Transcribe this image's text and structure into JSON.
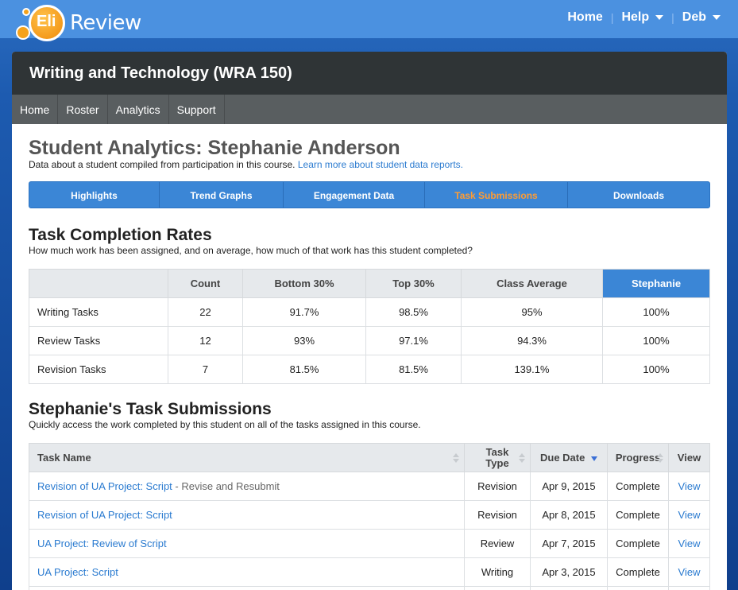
{
  "brand": {
    "logo_text": "Eli",
    "wordmark": "Review"
  },
  "topnav": {
    "home": "Home",
    "help": "Help",
    "user": "Deb"
  },
  "course": {
    "title": "Writing and Technology (WRA 150)"
  },
  "coursenav": [
    "Home",
    "Roster",
    "Analytics",
    "Support"
  ],
  "page": {
    "title": "Student Analytics: Stephanie Anderson",
    "subtitle": "Data about a student compiled from participation in this course.",
    "learn_more": "Learn more about student data reports."
  },
  "tabs": [
    {
      "label": "Highlights",
      "active": false
    },
    {
      "label": "Trend Graphs",
      "active": false
    },
    {
      "label": "Engagement Data",
      "active": false
    },
    {
      "label": "Task Submissions",
      "active": true
    },
    {
      "label": "Downloads",
      "active": false
    }
  ],
  "completion": {
    "heading": "Task Completion Rates",
    "description": "How much work has been assigned, and on average, how much of that work has this student completed?",
    "columns": [
      "",
      "Count",
      "Bottom 30%",
      "Top 30%",
      "Class Average",
      "Stephanie"
    ],
    "rows": [
      [
        "Writing Tasks",
        "22",
        "91.7%",
        "98.5%",
        "95%",
        "100%"
      ],
      [
        "Review Tasks",
        "12",
        "93%",
        "97.1%",
        "94.3%",
        "100%"
      ],
      [
        "Revision Tasks",
        "7",
        "81.5%",
        "81.5%",
        "139.1%",
        "100%"
      ]
    ]
  },
  "submissions": {
    "heading": "Stephanie's Task Submissions",
    "description": "Quickly access the work completed by this student on all of the tasks assigned in this course.",
    "columns": {
      "name": "Task Name",
      "type_line1": "Task",
      "type_line2": "Type",
      "due": "Due Date",
      "progress": "Progress",
      "view": "View"
    },
    "rows": [
      {
        "name": "Revision of UA Project: Script",
        "suffix": " - Revise and Resubmit",
        "type": "Revision",
        "due": "Apr 9, 2015",
        "progress": "Complete",
        "view": "View"
      },
      {
        "name": "Revision of UA Project: Script",
        "suffix": "",
        "type": "Revision",
        "due": "Apr 8, 2015",
        "progress": "Complete",
        "view": "View"
      },
      {
        "name": "UA Project: Review of Script",
        "suffix": "",
        "type": "Review",
        "due": "Apr 7, 2015",
        "progress": "Complete",
        "view": "View"
      },
      {
        "name": "UA Project: Script",
        "suffix": "",
        "type": "Writing",
        "due": "Apr 3, 2015",
        "progress": "Complete",
        "view": "View"
      }
    ]
  }
}
